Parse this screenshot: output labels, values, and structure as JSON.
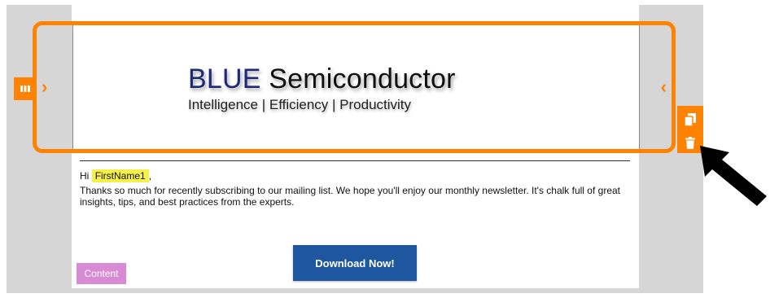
{
  "header": {
    "brand_blue": "BLUE",
    "brand_rest": "Semiconductor",
    "tagline": "Intelligence | Efficiency | Productivity"
  },
  "icons": {
    "row_handle": "columns-icon",
    "copy": "copy-icon",
    "delete": "trash-icon",
    "left_chevron": "chevron-right-icon",
    "right_chevron": "chevron-left-icon",
    "pointer": "arrow-pointer-icon"
  },
  "content": {
    "greeting_prefix": "Hi",
    "merge_tag": "FirstName1",
    "greeting_suffix": ",",
    "intro": "Thanks so much for recently subscribing to our mailing list. We hope you'll enjoy our monthly newsletter. It's chalk full of great insights, tips, and best practices from the experts.",
    "cta_label": "Download Now!",
    "content_badge": "Content"
  },
  "colors": {
    "selection": "#ff8200",
    "brand_blue": "#1e2a78",
    "button": "#1e56a0",
    "merge_tag": "#f5f04a",
    "content_badge": "#d98ad4"
  }
}
